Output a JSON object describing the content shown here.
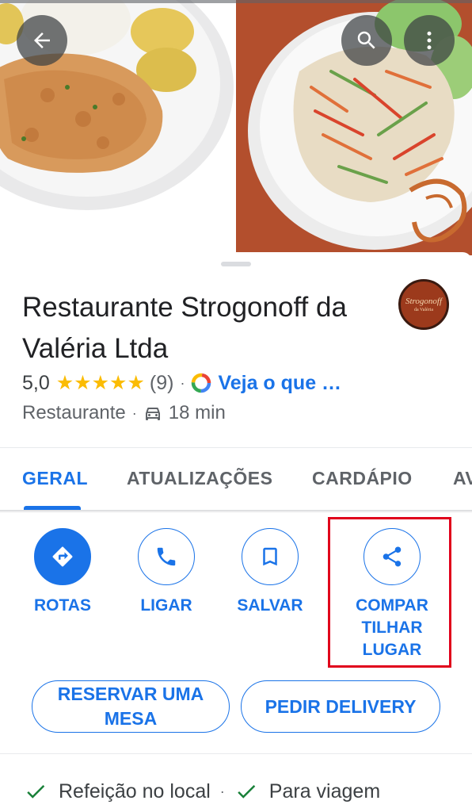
{
  "header": {
    "back_icon": "arrow-back-icon",
    "search_icon": "search-icon",
    "more_icon": "more-vert-icon"
  },
  "place": {
    "name": "Restaurante Strogonoff da Valéria Ltda",
    "logo_text": "Strogonoff",
    "logo_subtext": "da Valéria",
    "rating": "5,0",
    "stars": 5,
    "reviews": "(9)",
    "see_link": "Veja o que …",
    "category": "Restaurante",
    "drive_time": "18 min"
  },
  "tabs": [
    {
      "label": "GERAL",
      "active": true
    },
    {
      "label": "ATUALIZAÇÕES",
      "active": false
    },
    {
      "label": "CARDÁPIO",
      "active": false
    },
    {
      "label": "AVALIAÇÕES",
      "active": false
    }
  ],
  "actions": {
    "routes": "ROTAS",
    "call": "LIGAR",
    "save": "SALVAR",
    "share": "COMPARTILHAR LUGAR"
  },
  "pills": {
    "reserve": "RESERVAR UMA MESA",
    "delivery": "PEDIR DELIVERY"
  },
  "service_options": {
    "dine_in": "Refeição no local",
    "takeout": "Para viagem"
  },
  "colors": {
    "accent": "#1a73e8",
    "star": "#fbbc04",
    "check": "#188038",
    "highlight": "#e0001b"
  }
}
